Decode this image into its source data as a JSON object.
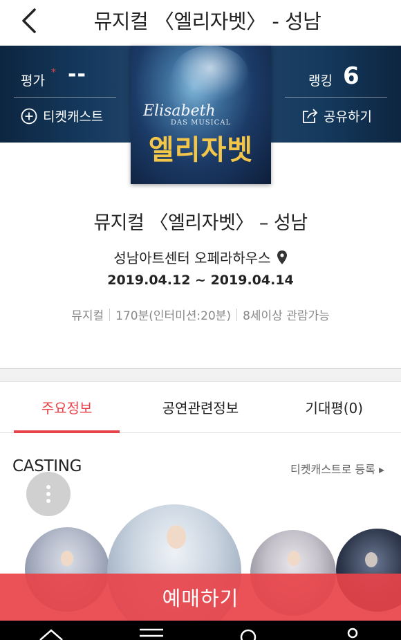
{
  "header": {
    "title": "뮤지컬 〈엘리자벳〉 - 성남"
  },
  "hero": {
    "rating_label": "평가",
    "rating_star": "*",
    "rating_value": "--",
    "ticketcast_label": "티켓캐스트",
    "ranking_label": "랭킹",
    "ranking_value": "6",
    "share_label": "공유하기"
  },
  "poster": {
    "script_title": "Elisabeth",
    "subtitle": "DAS MUSICAL",
    "title": "엘리자벳"
  },
  "info": {
    "title": "뮤지컬 〈엘리자벳〉 – 성남",
    "venue": "성남아트센터 오페라하우스",
    "period": "2019.04.12 ~ 2019.04.14",
    "meta": [
      "뮤지컬",
      "170분(인터미션:20분)",
      "8세이상 관람가능"
    ]
  },
  "tabs": [
    {
      "label": "주요정보",
      "active": true
    },
    {
      "label": "공연관련정보",
      "active": false
    },
    {
      "label": "기대평(0)",
      "active": false
    }
  ],
  "casting": {
    "title": "CASTING",
    "link_label": "티켓캐스트로 등록 ▸"
  },
  "book_button": {
    "label": "예매하기"
  },
  "colors": {
    "accent": "#e8434a",
    "hero_bg": "#143a5e",
    "poster_title": "#f3c64a"
  }
}
